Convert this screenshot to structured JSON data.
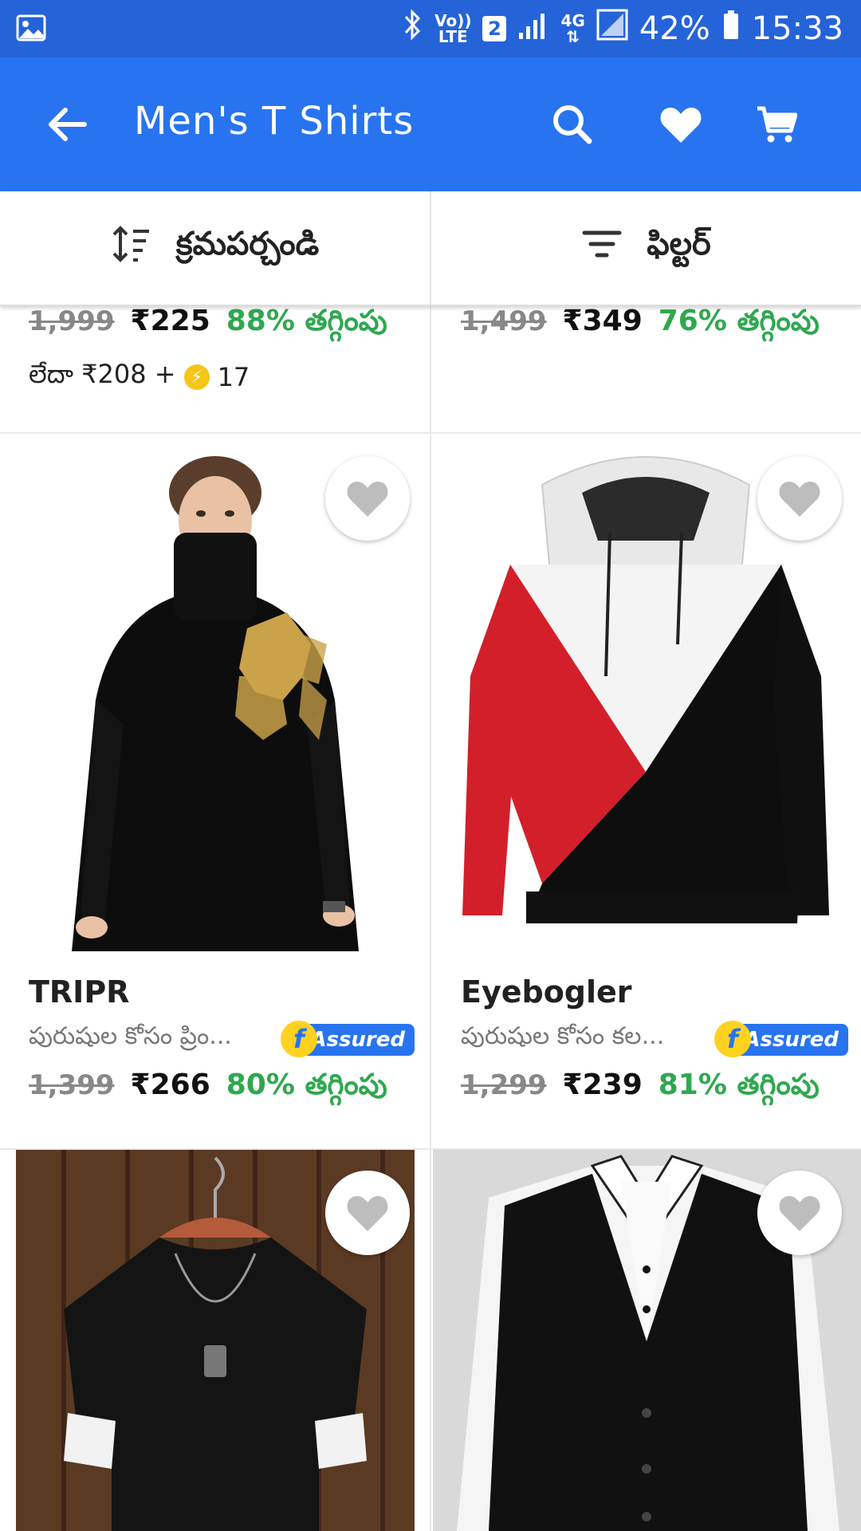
{
  "status_bar": {
    "network_label_top": "Vo))",
    "network_label_bottom": "LTE",
    "sim": "2",
    "data_label": "4G",
    "battery": "42%",
    "time": "15:33"
  },
  "app_bar": {
    "title": "Men's T Shirts",
    "color": "#2874f0"
  },
  "sort_filter": {
    "sort_label": "క్రమపర్చండి",
    "filter_label": "ఫిల్టర్"
  },
  "products_top": [
    {
      "mrp": "1,999",
      "price": "₹225",
      "discount": "88% తగ్గింపు",
      "coins_prefix": "లేదా ₹208 +",
      "coins": "17"
    },
    {
      "mrp": "1,499",
      "price": "₹349",
      "discount": "76% తగ్గింపు"
    }
  ],
  "products": [
    {
      "brand": "TRIPR",
      "subtitle": "పురుషుల కోసం ప్రిం...",
      "assured": "Assured",
      "mrp": "1,399",
      "price": "₹266",
      "discount": "80% తగ్గింపు"
    },
    {
      "brand": "Eyebogler",
      "subtitle": "పురుషుల కోసం కల...",
      "assured": "Assured",
      "mrp": "1,299",
      "price": "₹239",
      "discount": "81% తగ్గింపు"
    }
  ]
}
